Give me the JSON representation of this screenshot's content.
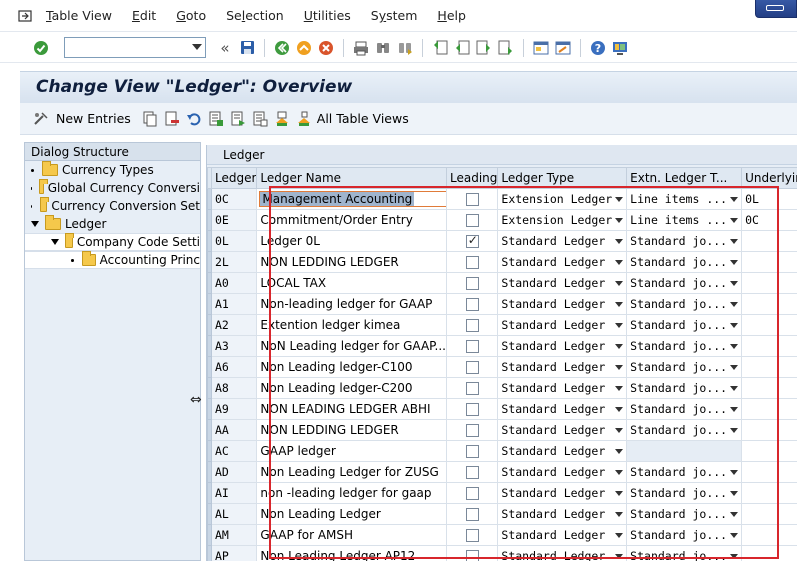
{
  "menu": {
    "items": [
      "Table View",
      "Edit",
      "Goto",
      "Selection",
      "Utilities",
      "System",
      "Help"
    ],
    "underline": [
      "T",
      "E",
      "G",
      "l",
      "U",
      "y",
      "H"
    ]
  },
  "toolbar": {
    "command_value": "",
    "icons": [
      "enter-icon",
      "save-icon",
      "back-icon",
      "exit-icon",
      "cancel-icon",
      "print-icon",
      "find-icon",
      "find-next-icon",
      "first-page-icon",
      "previous-page-icon",
      "next-page-icon",
      "last-page-icon",
      "create-session-icon",
      "shortcut-icon",
      "help-icon",
      "customize-layout-icon"
    ]
  },
  "title": "Change View \"Ledger\": Overview",
  "app_toolbar": {
    "new_entries": "New Entries",
    "all_table_views": "All Table Views"
  },
  "dialog": {
    "header": "Dialog Structure",
    "items": [
      {
        "label": "Currency Types",
        "level": 0,
        "expanded": false
      },
      {
        "label": "Global Currency Conversi",
        "level": 0,
        "expanded": false
      },
      {
        "label": "Currency Conversion Set",
        "level": 0,
        "expanded": false
      },
      {
        "label": "Ledger",
        "level": 0,
        "expanded": true,
        "selected": true
      },
      {
        "label": "Company Code Setti",
        "level": 1,
        "expanded": true
      },
      {
        "label": "Accounting Princ",
        "level": 2,
        "expanded": false
      }
    ]
  },
  "table": {
    "caption": "Ledger",
    "columns": [
      "Ledger",
      "Ledger Name",
      "Leading",
      "Ledger Type",
      "Extn. Ledger T...",
      "Underlyin"
    ],
    "rows": [
      {
        "ledger": "0C",
        "name": "Management Accounting",
        "leading": false,
        "type": "Extension Ledger",
        "extn": "Line items ...",
        "under": "0L"
      },
      {
        "ledger": "0E",
        "name": "Commitment/Order Entry",
        "leading": false,
        "type": "Extension Ledger",
        "extn": "Line items ...",
        "under": "0C"
      },
      {
        "ledger": "0L",
        "name": "Ledger 0L",
        "leading": true,
        "type": "Standard Ledger",
        "extn": "Standard jo...",
        "under": ""
      },
      {
        "ledger": "2L",
        "name": "NON LEDDING LEDGER",
        "leading": false,
        "type": "Standard Ledger",
        "extn": "Standard jo...",
        "under": ""
      },
      {
        "ledger": "A0",
        "name": "LOCAL TAX",
        "leading": false,
        "type": "Standard Ledger",
        "extn": "Standard jo...",
        "under": ""
      },
      {
        "ledger": "A1",
        "name": "Non-leading ledger for GAAP",
        "leading": false,
        "type": "Standard Ledger",
        "extn": "Standard jo...",
        "under": ""
      },
      {
        "ledger": "A2",
        "name": "Extention ledger kimea",
        "leading": false,
        "type": "Standard Ledger",
        "extn": "Standard jo...",
        "under": ""
      },
      {
        "ledger": "A3",
        "name": "NoN Leading ledger for GAAP...",
        "leading": false,
        "type": "Standard Ledger",
        "extn": "Standard jo...",
        "under": ""
      },
      {
        "ledger": "A6",
        "name": "Non Leading ledger-C100",
        "leading": false,
        "type": "Standard Ledger",
        "extn": "Standard jo...",
        "under": ""
      },
      {
        "ledger": "A8",
        "name": "Non Leading ledger-C200",
        "leading": false,
        "type": "Standard Ledger",
        "extn": "Standard jo...",
        "under": ""
      },
      {
        "ledger": "A9",
        "name": "NON LEADING LEDGER ABHI",
        "leading": false,
        "type": "Standard Ledger",
        "extn": "Standard jo...",
        "under": ""
      },
      {
        "ledger": "AA",
        "name": "NON LEDDING LEDGER",
        "leading": false,
        "type": "Standard Ledger",
        "extn": "Standard jo...",
        "under": ""
      },
      {
        "ledger": "AC",
        "name": "GAAP ledger",
        "leading": false,
        "type": "Standard Ledger",
        "extn": "",
        "under": ""
      },
      {
        "ledger": "AD",
        "name": "Non Leading Ledger for ZUSG",
        "leading": false,
        "type": "Standard Ledger",
        "extn": "Standard jo...",
        "under": ""
      },
      {
        "ledger": "AI",
        "name": "non -leading ledger for gaap",
        "leading": false,
        "type": "Standard Ledger",
        "extn": "Standard jo...",
        "under": ""
      },
      {
        "ledger": "AL",
        "name": "Non Leading Ledger",
        "leading": false,
        "type": "Standard Ledger",
        "extn": "Standard jo...",
        "under": ""
      },
      {
        "ledger": "AM",
        "name": "GAAP for AMSH",
        "leading": false,
        "type": "Standard Ledger",
        "extn": "Standard jo...",
        "under": ""
      },
      {
        "ledger": "AP",
        "name": "Non Leading Ledger AP12",
        "leading": false,
        "type": "Standard Ledger",
        "extn": "Standard jo...",
        "under": ""
      }
    ]
  },
  "colors": {
    "highlight_box": "#d8262c",
    "title_bg": "#dfe8f2",
    "tree_folder": "#f5c84b"
  }
}
